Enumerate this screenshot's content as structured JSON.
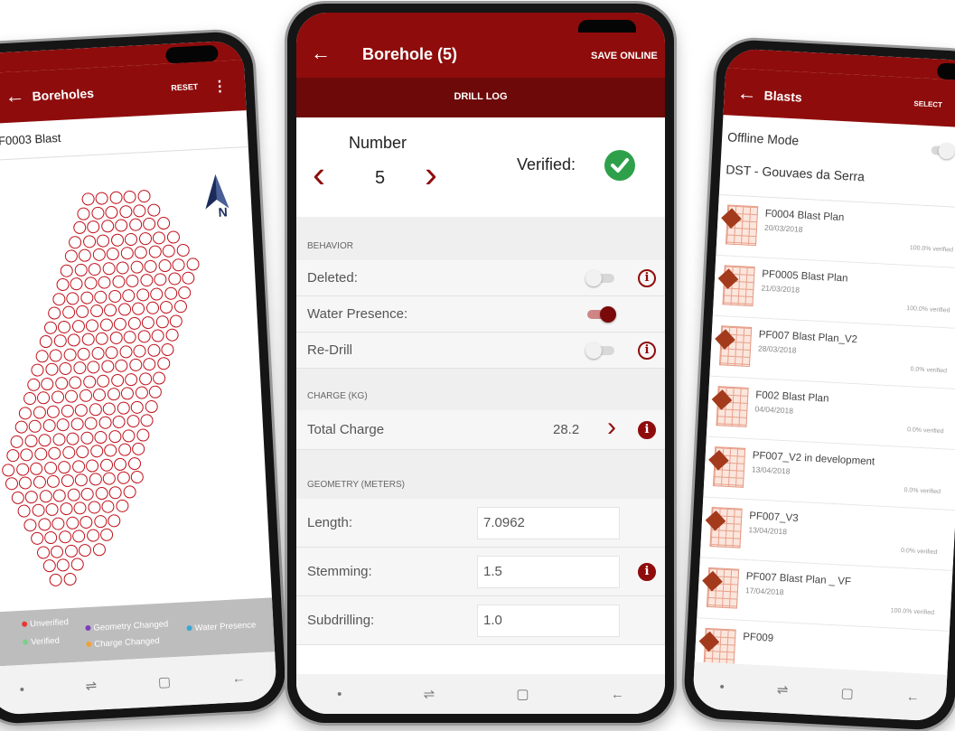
{
  "left": {
    "title": "Boreholes",
    "action": "RESET",
    "menu_glyph": "⋮",
    "back_glyph": "←",
    "subtitle": "F0003 Blast",
    "compass_letter": "N",
    "legend": [
      "Unverified",
      "Verified",
      "Geometry Changed",
      "Charge Changed",
      "Water Presence"
    ],
    "legend_colors": [
      "#e53935",
      "#7cd08a",
      "#7b3fbf",
      "#f0a23a",
      "#3aa7d8"
    ],
    "nav": [
      "•",
      "⇌",
      "▢",
      "←"
    ]
  },
  "center": {
    "title": "Borehole (5)",
    "action": "SAVE ONLINE",
    "back_glyph": "←",
    "tab": "DRILL LOG",
    "number_label": "Number",
    "number_value": "5",
    "prev_glyph": "‹",
    "next_glyph": "›",
    "verified_label": "Verified:",
    "sections": {
      "behavior": "BEHAVIOR",
      "charge": "CHARGE (KG)",
      "geometry": "GEOMETRY (METERS)"
    },
    "behavior_rows": [
      {
        "label": "Deleted:",
        "on": false,
        "info": true
      },
      {
        "label": "Water Presence:",
        "on": true,
        "info": false
      },
      {
        "label": "Re-Drill",
        "on": false,
        "info": true
      }
    ],
    "charge_row": {
      "label": "Total Charge",
      "value": "28.2"
    },
    "geometry_rows": [
      {
        "label": "Length:",
        "value": "7.0962",
        "warn": false
      },
      {
        "label": "Stemming:",
        "value": "1.5",
        "warn": true
      },
      {
        "label": "Subdrilling:",
        "value": "1.0",
        "warn": false
      }
    ],
    "nav": [
      "•",
      "⇌",
      "▢",
      "←"
    ],
    "accent": "#8f0c0c"
  },
  "right": {
    "title": "Blasts",
    "action": "SELECT",
    "menu_glyph": "⋮",
    "back_glyph": "←",
    "offline_label": "Offline Mode",
    "site": "DST - Gouvaes da Serra",
    "items": [
      {
        "name": "F0004 Blast Plan",
        "date": "20/03/2018",
        "pct": "100.0% verified"
      },
      {
        "name": "PF0005 Blast Plan",
        "date": "21/03/2018",
        "pct": "100.0% verified"
      },
      {
        "name": "PF007 Blast Plan_V2",
        "date": "28/03/2018",
        "pct": "0.0% verified"
      },
      {
        "name": "F002 Blast Plan",
        "date": "04/04/2018",
        "pct": "0.0% verified"
      },
      {
        "name": "PF007_V2 in development",
        "date": "13/04/2018",
        "pct": "0.0% verified"
      },
      {
        "name": "PF007_V3",
        "date": "13/04/2018",
        "pct": "0.0% verified"
      },
      {
        "name": "PF007 Blast Plan _ VF",
        "date": "17/04/2018",
        "pct": "100.0% verified"
      },
      {
        "name": "PF009",
        "date": "",
        "pct": ""
      }
    ],
    "nav": [
      "•",
      "⇌",
      "▢",
      "←"
    ]
  }
}
